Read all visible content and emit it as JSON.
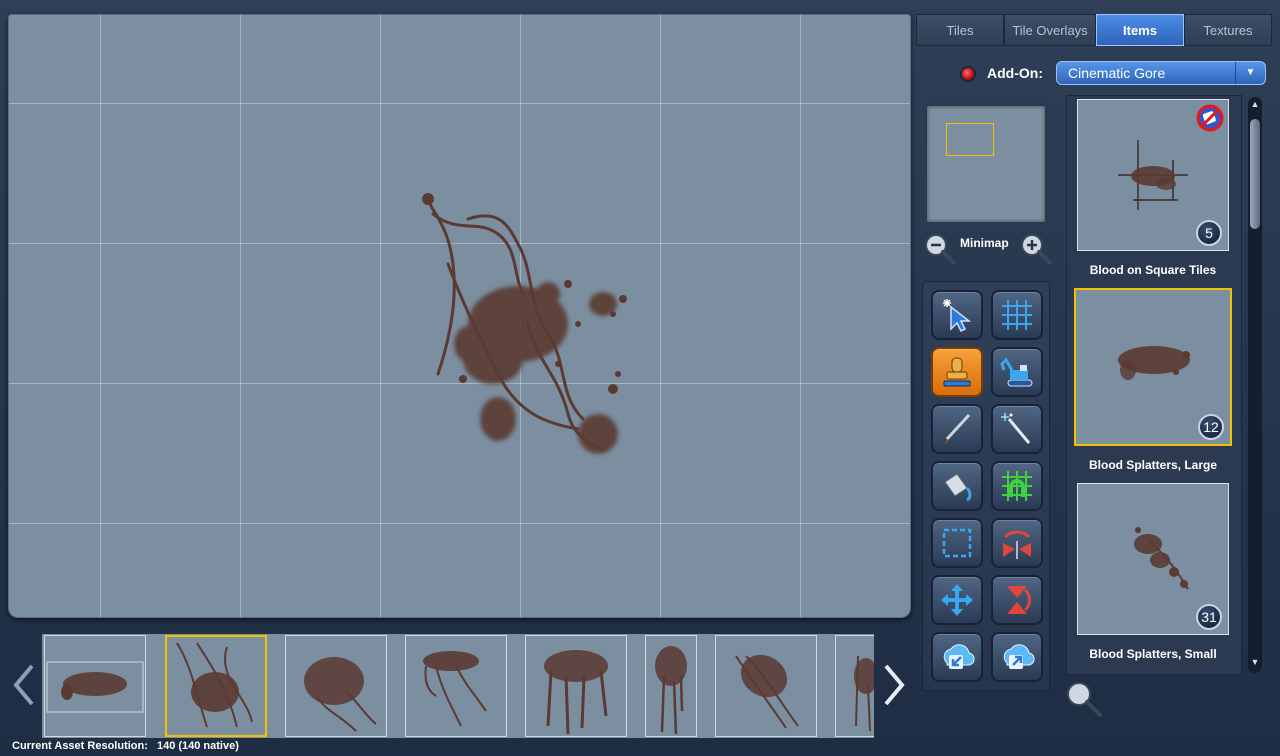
{
  "tabs": [
    {
      "label": "Tiles",
      "active": false
    },
    {
      "label": "Tile Overlays",
      "active": false
    },
    {
      "label": "Items",
      "active": true
    },
    {
      "label": "Textures",
      "active": false
    }
  ],
  "addon": {
    "label": "Add-On:",
    "selected": "Cinematic Gore"
  },
  "minimap": {
    "label": "Minimap"
  },
  "tools": [
    {
      "name": "select-tool-icon",
      "active": false
    },
    {
      "name": "grid-tool-icon",
      "active": false
    },
    {
      "name": "stamp-tool-icon",
      "active": true
    },
    {
      "name": "excavator-tool-icon",
      "active": false
    },
    {
      "name": "brush-tool-icon",
      "active": false
    },
    {
      "name": "magic-wand-tool-icon",
      "active": false
    },
    {
      "name": "paint-bucket-tool-icon",
      "active": false
    },
    {
      "name": "snap-grid-tool-icon",
      "active": false
    },
    {
      "name": "marquee-select-tool-icon",
      "active": false
    },
    {
      "name": "flip-horizontal-tool-icon",
      "active": false
    },
    {
      "name": "move-tool-icon",
      "active": false
    },
    {
      "name": "flip-vertical-tool-icon",
      "active": false
    },
    {
      "name": "import-tool-icon",
      "active": false
    },
    {
      "name": "export-tool-icon",
      "active": false
    }
  ],
  "assets": [
    {
      "label": "Blood on Square Tiles",
      "count": "5",
      "selected": false
    },
    {
      "label": "Blood Splatters, Large",
      "count": "12",
      "selected": true
    },
    {
      "label": "Blood Splatters, Small",
      "count": "31",
      "selected": false
    }
  ],
  "filmstrip": {
    "selected_index": 1,
    "item_count": 8
  },
  "status": {
    "label": "Current Asset Resolution:",
    "value": "140 (140 native)"
  },
  "colors": {
    "accent": "#3b7ad6",
    "selection": "#f2c200",
    "canvas": "#7b8fa0",
    "blood": "#5a3a33"
  }
}
